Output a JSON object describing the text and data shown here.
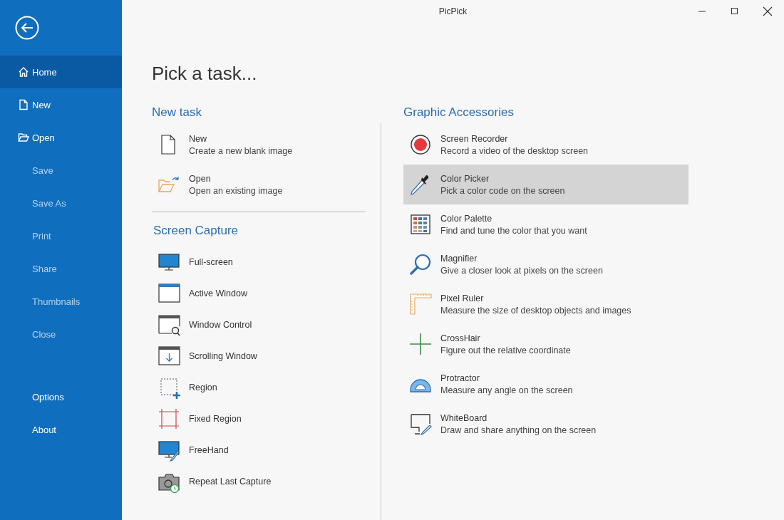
{
  "window": {
    "title": "PicPick"
  },
  "sidebar": {
    "items": [
      {
        "label": "Home",
        "selected": true,
        "disabled": false
      },
      {
        "label": "New",
        "selected": false,
        "disabled": false
      },
      {
        "label": "Open",
        "selected": false,
        "disabled": false
      },
      {
        "label": "Save",
        "selected": false,
        "disabled": true
      },
      {
        "label": "Save As",
        "selected": false,
        "disabled": true
      },
      {
        "label": "Print",
        "selected": false,
        "disabled": true
      },
      {
        "label": "Share",
        "selected": false,
        "disabled": true
      },
      {
        "label": "Thumbnails",
        "selected": false,
        "disabled": true
      },
      {
        "label": "Close",
        "selected": false,
        "disabled": true
      }
    ],
    "bottom_items": [
      {
        "label": "Options",
        "selected": false,
        "disabled": false
      },
      {
        "label": "About",
        "selected": false,
        "disabled": false
      }
    ]
  },
  "page_title": "Pick a task...",
  "new_task": {
    "heading": "New task",
    "items": [
      {
        "title": "New",
        "description": "Create a new blank image"
      },
      {
        "title": "Open",
        "description": "Open an existing image"
      }
    ]
  },
  "screen_capture": {
    "heading": "Screen Capture",
    "items": [
      {
        "title": "Full-screen"
      },
      {
        "title": "Active Window"
      },
      {
        "title": "Window Control"
      },
      {
        "title": "Scrolling Window"
      },
      {
        "title": "Region"
      },
      {
        "title": "Fixed Region"
      },
      {
        "title": "FreeHand"
      },
      {
        "title": "Repeat Last Capture"
      }
    ]
  },
  "graphic_accessories": {
    "heading": "Graphic Accessories",
    "items": [
      {
        "title": "Screen Recorder",
        "description": "Record a video of the desktop screen",
        "selected": false
      },
      {
        "title": "Color Picker",
        "description": "Pick a color code on the screen",
        "selected": true
      },
      {
        "title": "Color Palette",
        "description": "Find and tune the color that you want",
        "selected": false
      },
      {
        "title": "Magnifier",
        "description": "Give a closer look at pixels on the screen",
        "selected": false
      },
      {
        "title": "Pixel Ruler",
        "description": "Measure the size of desktop objects and images",
        "selected": false
      },
      {
        "title": "CrossHair",
        "description": "Figure out the relative coordinate",
        "selected": false
      },
      {
        "title": "Protractor",
        "description": "Measure any angle on the screen",
        "selected": false
      },
      {
        "title": "WhiteBoard",
        "description": "Draw and share anything on the screen",
        "selected": false
      }
    ]
  }
}
